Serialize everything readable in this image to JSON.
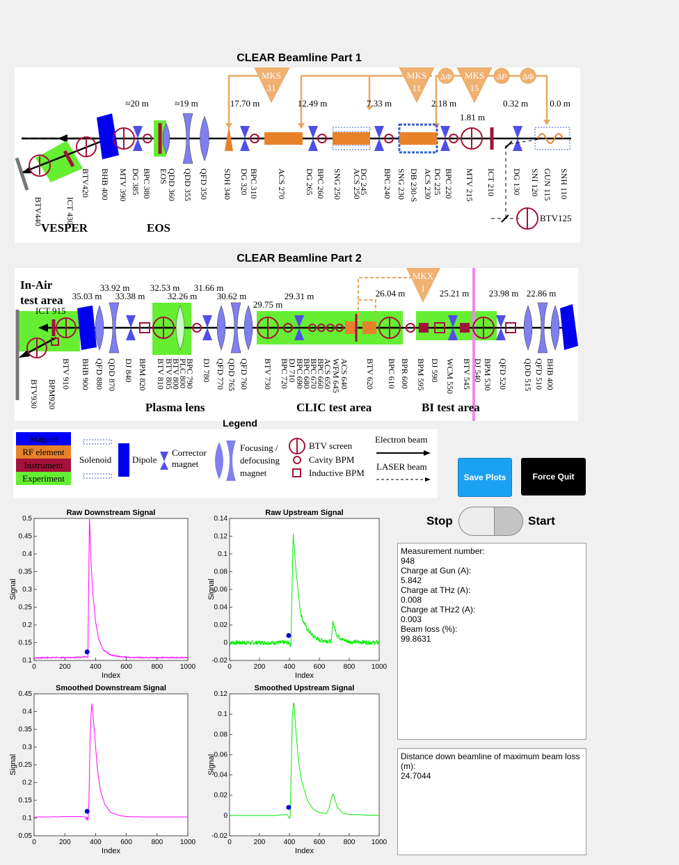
{
  "beamline1": {
    "title": "CLEAR Beamline Part 1",
    "distances": [
      "≈20 m",
      "≈19 m",
      "17.70 m",
      "12.49 m",
      "7.33 m",
      "2.18 m",
      "1.81 m",
      "0.32 m",
      "0.0 m"
    ],
    "rf_sources": [
      "MKS\n31",
      "MKS\n11",
      "MKS\n15"
    ],
    "phase_nodes": [
      "ΔΦ",
      "ΔP",
      "ΔΦ"
    ],
    "element_labels": [
      "BTV440",
      "ICT 430",
      "BTV420",
      "BHB 400",
      "MTV 390",
      "DG 385",
      "BPC 380",
      "EOS",
      "QDD 360",
      "QDD 355",
      "QFD 350",
      "SDH 340",
      "DG 320",
      "BPC 310",
      "ACS 270",
      "DG 265",
      "BPC 260",
      "SNG 250",
      "ACS 250",
      "DG 245",
      "BPC 240",
      "SNG 230",
      "DB 230-S",
      "ACS 230",
      "DG 225",
      "BPC 220",
      "MTV 215",
      "ICT 210",
      "DG 130",
      "SNI 120",
      "GUN 115",
      "SNH 110"
    ],
    "btv_label": "BTV125",
    "areas": [
      "VESPER",
      "EOS"
    ]
  },
  "beamline2": {
    "title": "CLEAR Beamline Part 2",
    "in_air": "In-Air\ntest area",
    "ict_label": "ICT 915",
    "rf_source": "MKX\n1",
    "distances": [
      "35.03 m",
      "33.92 m",
      "33.38 m",
      "32.53 m",
      "32.26 m",
      "31.66 m",
      "30.62 m",
      "29.75 m",
      "29.31 m",
      "26.04 m",
      "25.21 m",
      "23.98 m",
      "22.86 m"
    ],
    "element_labels": [
      "BTV930",
      "BPM920",
      "BTV 910",
      "BHB 900",
      "QFD 880",
      "QDD 870",
      "DJ 840",
      "BPM 820",
      "BTV 810",
      "BTV 805",
      "BTV 800",
      "PLC 800",
      "BPC 790",
      "DJ 780",
      "QFD 770",
      "QDD 765",
      "QFD 760",
      "BTV 730",
      "BPC 720",
      "DJ 710",
      "BPC 690",
      "BPC 680",
      "BPC 670",
      "BPC 660",
      "ACS 650",
      "WFM 645",
      "ACS 640",
      "BTV 620",
      "BPC 610",
      "BPR 600",
      "BPM 595",
      "DJ 590",
      "WCM 550",
      "BTV 545",
      "DJ 540",
      "BPM 530",
      "QFD 520",
      "QDD 515",
      "QFD 510",
      "BHB 400"
    ],
    "areas": [
      "Plasma lens",
      "CLIC test area",
      "BI test area"
    ]
  },
  "legend": {
    "title": "Legend",
    "categories": [
      {
        "label": "Magnet",
        "color": "#0000ff"
      },
      {
        "label": "RF element",
        "color": "#e8822a"
      },
      {
        "label": "Instrument",
        "color": "#a3123a"
      },
      {
        "label": "Experiment",
        "color": "#66ee33"
      }
    ],
    "solenoid": "Solenoid",
    "dipole": "Dipole",
    "corrector": "Corrector\nmagnet",
    "focusing": "Focusing /\ndefocusing\nmagnet",
    "btv_screen": "BTV screen",
    "cavity_bpm": "Cavity BPM",
    "inductive_bpm": "Inductive BPM",
    "electron_beam": "Electron beam",
    "laser_beam": "LASER beam"
  },
  "controls": {
    "save_label": "Save Plots",
    "quit_label": "Force Quit",
    "stop_label": "Stop",
    "start_label": "Start",
    "toggle_state": "stop"
  },
  "info": {
    "text": "Measurement number:\n948\nCharge at Gun (A):\n5.842\nCharge at THz (A):\n0.008\nCharge at THz2 (A):\n0.003\nBeam loss (%):\n99.8631",
    "distance_text": "Distance down beamline of maximum beam loss (m):\n24.7044"
  },
  "chart_data": [
    {
      "type": "line",
      "title": "Raw Downstream Signal",
      "xlabel": "Index",
      "ylabel": "Signal",
      "xlim": [
        0,
        1000
      ],
      "ylim": [
        0.1,
        0.5
      ],
      "xticks": [
        "0",
        "200",
        "400",
        "600",
        "800",
        "1000"
      ],
      "yticks": [
        "0.1",
        "0.15",
        "0.2",
        "0.25",
        "0.3",
        "0.35",
        "0.4",
        "0.45",
        "0.5"
      ],
      "color": "#ff00ff",
      "noise": 0.0015,
      "x": [
        0,
        100,
        200,
        300,
        340,
        350,
        360,
        365,
        370,
        380,
        400,
        420,
        450,
        500,
        550,
        600,
        700,
        800,
        1000
      ],
      "y": [
        0.107,
        0.108,
        0.108,
        0.109,
        0.11,
        0.107,
        0.5,
        0.45,
        0.38,
        0.3,
        0.21,
        0.16,
        0.13,
        0.115,
        0.111,
        0.109,
        0.108,
        0.108,
        0.108
      ],
      "marker": {
        "x": 345,
        "y": 0.124,
        "color": "#0000cc"
      }
    },
    {
      "type": "line",
      "title": "Raw Upstream Signal",
      "xlabel": "Index",
      "ylabel": "Signal",
      "xlim": [
        0,
        1000
      ],
      "ylim": [
        -0.02,
        0.14
      ],
      "xticks": [
        "0",
        "200",
        "400",
        "600",
        "800",
        "1000"
      ],
      "yticks": [
        "-0.02",
        "0",
        "0.02",
        "0.04",
        "0.06",
        "0.08",
        "0.1",
        "0.12",
        "0.14"
      ],
      "color": "#00ee00",
      "noise": 0.0025,
      "x": [
        0,
        100,
        200,
        300,
        380,
        400,
        410,
        420,
        425,
        440,
        460,
        470,
        475,
        490,
        520,
        560,
        600,
        650,
        680,
        690,
        700,
        720,
        760,
        800,
        1000
      ],
      "y": [
        0,
        0,
        0,
        0,
        0,
        0,
        -0.004,
        0.08,
        0.123,
        0.09,
        0.055,
        0.04,
        0.034,
        0.025,
        0.015,
        0.007,
        0.003,
        0.002,
        0.001,
        0.025,
        0.018,
        0.008,
        0.003,
        0.001,
        0
      ],
      "marker": {
        "x": 395,
        "y": 0.008,
        "color": "#0000cc"
      }
    },
    {
      "type": "line",
      "title": "Smoothed Downstream Signal",
      "xlabel": "Index",
      "ylabel": "Signal",
      "xlim": [
        0,
        1000
      ],
      "ylim": [
        0.05,
        0.48
      ],
      "xticks": [
        "0",
        "200",
        "400",
        "600",
        "800",
        "1000"
      ],
      "yticks": [
        "0.05",
        "0.1",
        "0.15",
        "0.2",
        "0.25",
        "0.3",
        "0.35",
        "0.4",
        "0.45"
      ],
      "color": "#ff00ff",
      "noise": 0,
      "x": [
        0,
        100,
        200,
        300,
        335,
        340,
        345,
        350,
        355,
        365,
        375,
        390,
        410,
        430,
        460,
        500,
        550,
        600,
        700,
        800,
        1000
      ],
      "y": [
        0.107,
        0.107,
        0.108,
        0.108,
        0.107,
        0.098,
        0.11,
        0.09,
        0.12,
        0.36,
        0.455,
        0.38,
        0.26,
        0.19,
        0.145,
        0.12,
        0.112,
        0.108,
        0.107,
        0.107,
        0.107
      ],
      "marker": {
        "x": 345,
        "y": 0.124,
        "color": "#0000cc"
      }
    },
    {
      "type": "line",
      "title": "Smoothed Upstream Signal",
      "xlabel": "Index",
      "ylabel": "Signal",
      "xlim": [
        0,
        1000
      ],
      "ylim": [
        -0.02,
        0.12
      ],
      "xticks": [
        "0",
        "200",
        "400",
        "600",
        "800",
        "1000"
      ],
      "yticks": [
        "-0.02",
        "0",
        "0.02",
        "0.04",
        "0.06",
        "0.08",
        "0.1",
        "0.12"
      ],
      "color": "#00ee00",
      "noise": 0,
      "x": [
        0,
        100,
        200,
        300,
        380,
        395,
        400,
        405,
        410,
        420,
        430,
        440,
        460,
        480,
        520,
        560,
        600,
        650,
        670,
        690,
        700,
        720,
        760,
        800,
        1000
      ],
      "y": [
        0,
        0,
        0,
        0,
        0.001,
        -0.001,
        -0.003,
        -0.002,
        0.03,
        0.1,
        0.114,
        0.09,
        0.055,
        0.035,
        0.015,
        0.006,
        0.003,
        0.002,
        0.01,
        0.022,
        0.018,
        0.008,
        0.002,
        0.001,
        0
      ],
      "marker": {
        "x": 395,
        "y": 0.008,
        "color": "#0000cc"
      }
    }
  ]
}
